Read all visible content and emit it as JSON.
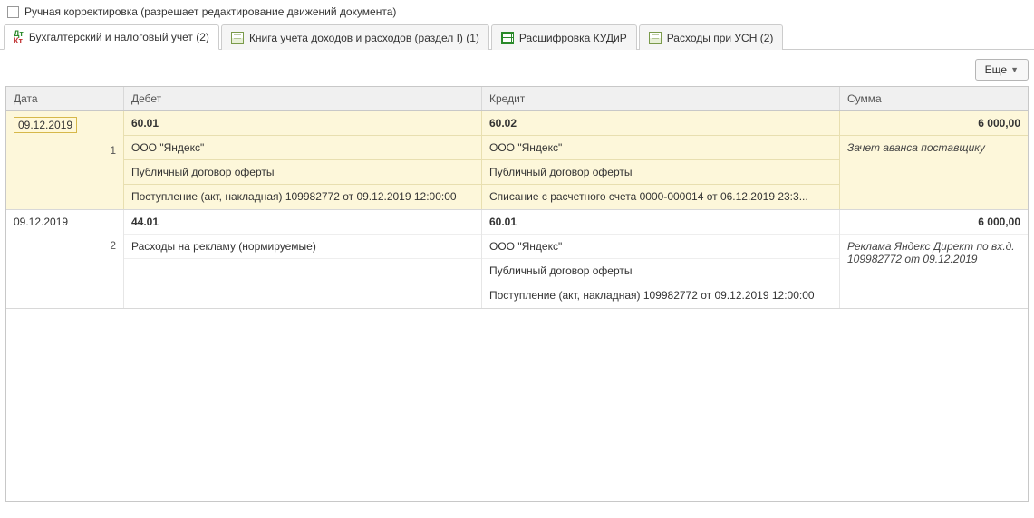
{
  "topCheckbox": {
    "label": "Ручная корректировка (разрешает редактирование движений документа)"
  },
  "tabs": [
    {
      "label": "Бухгалтерский и налоговый учет (2)"
    },
    {
      "label": "Книга учета доходов и расходов (раздел I) (1)"
    },
    {
      "label": "Расшифровка КУДиР"
    },
    {
      "label": "Расходы при УСН (2)"
    }
  ],
  "moreButton": "Еще",
  "columns": {
    "date": "Дата",
    "debit": "Дебет",
    "credit": "Кредит",
    "sum": "Сумма"
  },
  "entries": [
    {
      "n": "1",
      "date": "09.12.2019",
      "debitAcct": "60.01",
      "debitLines": [
        "ООО \"Яндекс\"",
        "Публичный договор оферты",
        "Поступление (акт, накладная) 109982772 от 09.12.2019 12:00:00"
      ],
      "creditAcct": "60.02",
      "creditLines": [
        "ООО \"Яндекс\"",
        "Публичный договор оферты",
        "Списание с расчетного счета 0000-000014 от 06.12.2019 23:3..."
      ],
      "amount": "6 000,00",
      "desc": "Зачет аванса поставщику"
    },
    {
      "n": "2",
      "date": "09.12.2019",
      "debitAcct": "44.01",
      "debitLines": [
        "Расходы на рекламу (нормируемые)"
      ],
      "creditAcct": "60.01",
      "creditLines": [
        "ООО \"Яндекс\"",
        "Публичный договор оферты",
        "Поступление (акт, накладная) 109982772 от 09.12.2019 12:00:00"
      ],
      "amount": "6 000,00",
      "desc": "Реклама Яндекс Директ по вх.д. 109982772 от 09.12.2019"
    }
  ]
}
